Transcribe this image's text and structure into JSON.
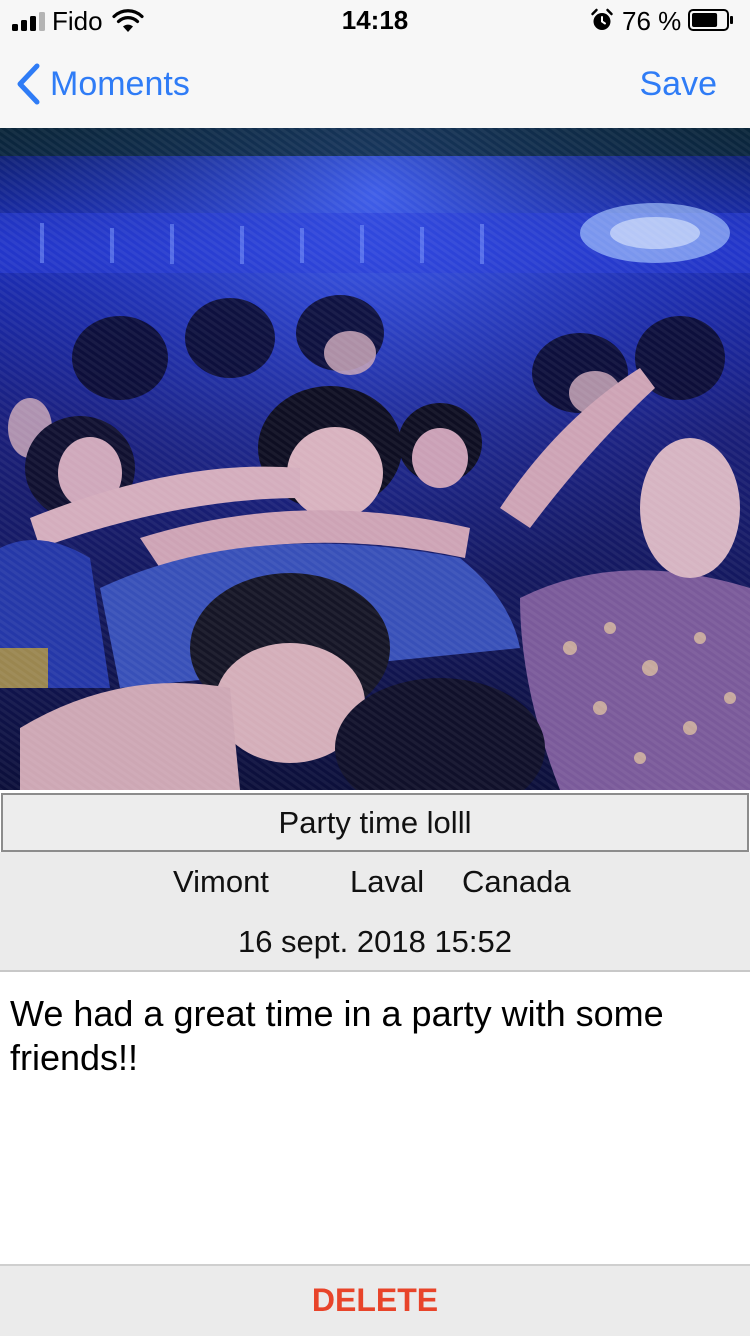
{
  "status_bar": {
    "carrier": "Fido",
    "time": "14:18",
    "battery_percent_text": "76 %",
    "battery_level": 0.76,
    "signal_bars_filled": 3,
    "signal_bars_total": 4,
    "icons": [
      "signal-icon",
      "wifi-icon",
      "alarm-icon",
      "battery-icon"
    ]
  },
  "nav": {
    "back_label": "Moments",
    "save_label": "Save",
    "accent_color": "#2f7cf6"
  },
  "photo": {
    "description_icon": "party-photo"
  },
  "memory": {
    "title": "Party time lolll",
    "location": {
      "city": "Vimont",
      "region": "Laval",
      "country": "Canada"
    },
    "date": "16 sept. 2018 15:52",
    "description": "We had a great time in a party with some friends!!"
  },
  "actions": {
    "delete_label": "DELETE",
    "delete_color": "#e8442a"
  }
}
